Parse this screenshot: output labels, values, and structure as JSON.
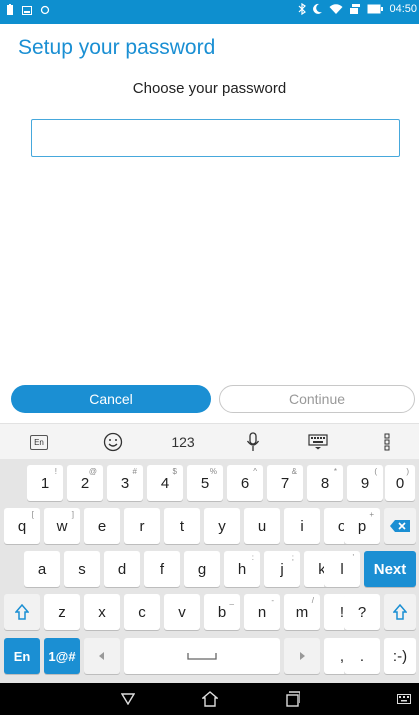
{
  "status_bar": {
    "time": "04:50"
  },
  "page": {
    "title": "Setup your password",
    "subtitle": "Choose your password",
    "password_value": ""
  },
  "buttons": {
    "cancel": "Cancel",
    "continue": "Continue"
  },
  "keyboard_toolbar": {
    "lang": "En",
    "numbers": "123"
  },
  "keyboard": {
    "row1": [
      {
        "key": "1",
        "hint": "!"
      },
      {
        "key": "2",
        "hint": "@"
      },
      {
        "key": "3",
        "hint": "#"
      },
      {
        "key": "4",
        "hint": "$"
      },
      {
        "key": "5",
        "hint": "%"
      },
      {
        "key": "6",
        "hint": "^"
      },
      {
        "key": "7",
        "hint": "&"
      },
      {
        "key": "8",
        "hint": "*"
      },
      {
        "key": "9",
        "hint": "("
      },
      {
        "key": "0",
        "hint": ")"
      }
    ],
    "row2": [
      {
        "key": "q",
        "hint": "["
      },
      {
        "key": "w",
        "hint": "]"
      },
      {
        "key": "e",
        "hint": ""
      },
      {
        "key": "r",
        "hint": ""
      },
      {
        "key": "t",
        "hint": ""
      },
      {
        "key": "y",
        "hint": ""
      },
      {
        "key": "u",
        "hint": ""
      },
      {
        "key": "i",
        "hint": ""
      },
      {
        "key": "o",
        "hint": ""
      },
      {
        "key": "p",
        "hint": "+"
      }
    ],
    "row3": [
      {
        "key": "a",
        "hint": ""
      },
      {
        "key": "s",
        "hint": ""
      },
      {
        "key": "d",
        "hint": ""
      },
      {
        "key": "f",
        "hint": ""
      },
      {
        "key": "g",
        "hint": ""
      },
      {
        "key": "h",
        "hint": ":"
      },
      {
        "key": "j",
        "hint": ";"
      },
      {
        "key": "k",
        "hint": "\""
      },
      {
        "key": "l",
        "hint": "'"
      }
    ],
    "next_label": "Next",
    "row4": [
      {
        "key": "z",
        "hint": ""
      },
      {
        "key": "x",
        "hint": ""
      },
      {
        "key": "c",
        "hint": ""
      },
      {
        "key": "v",
        "hint": ""
      },
      {
        "key": "b",
        "hint": "_"
      },
      {
        "key": "n",
        "hint": "-"
      },
      {
        "key": "m",
        "hint": "/"
      },
      {
        "key": "!",
        "hint": ""
      },
      {
        "key": "?",
        "hint": ""
      }
    ],
    "row5": {
      "en": "En",
      "symbols": "1@#",
      "comma": ",",
      "period": ".",
      "emoticon": ":-)"
    }
  },
  "colors": {
    "accent": "#1b8fd3",
    "status_bar": "#0e8fcf"
  }
}
